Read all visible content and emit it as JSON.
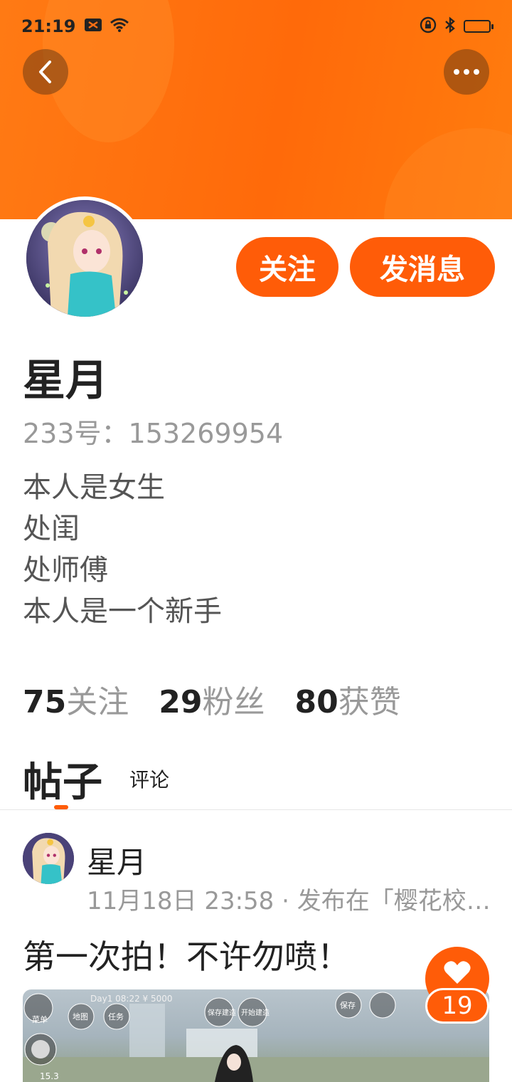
{
  "status_bar": {
    "time": "21:19"
  },
  "profile": {
    "name": "星月",
    "uid_line": "233号：153269954",
    "bio_lines": [
      "本人是女生",
      "处闺",
      "处师傅",
      "本人是一个新手"
    ],
    "follow_button": "关注",
    "message_button": "发消息"
  },
  "stats": [
    {
      "num": "75",
      "label": "关注"
    },
    {
      "num": "29",
      "label": "粉丝"
    },
    {
      "num": "80",
      "label": "获赞"
    }
  ],
  "tabs": {
    "posts": "帖子",
    "comments": "评论"
  },
  "post": {
    "author": "星月",
    "meta": "11月18日 23:58 · 发布在「樱花校…",
    "title": "第一次拍！不许勿喷！",
    "likes": "19",
    "image_overlay": {
      "menu": "菜单",
      "map": "地图",
      "task": "任务",
      "day_info": "Day1 08:22  ¥ 5000",
      "save_build": "保存建造",
      "start_build": "开始建造",
      "save": "保存",
      "speed": "15.3"
    }
  },
  "colors": {
    "accent": "#ff5c08",
    "header": "#ff7014"
  }
}
